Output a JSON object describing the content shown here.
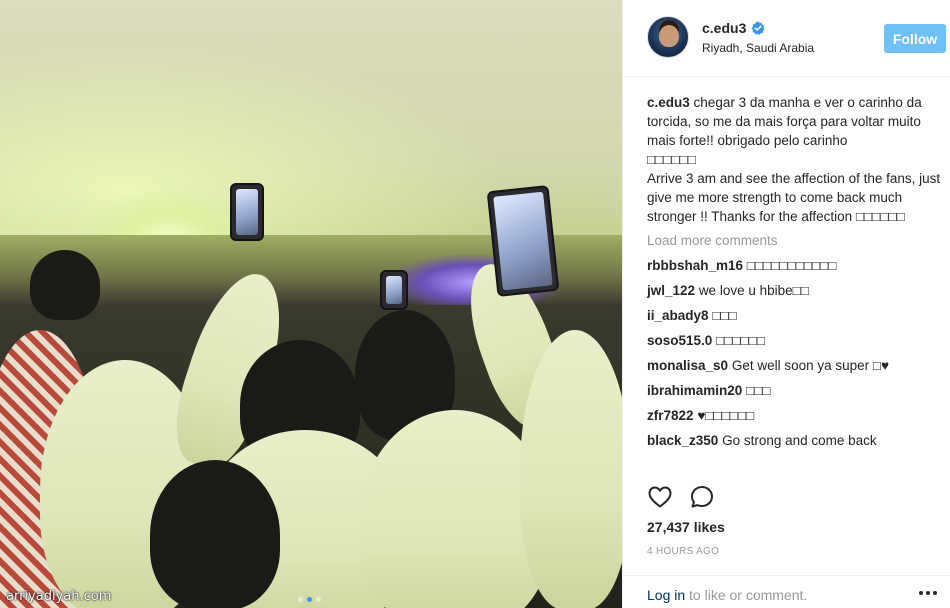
{
  "watermark": "arriyadiyah.com",
  "post": {
    "username": "c.edu3",
    "location": "Riyadh, Saudi Arabia",
    "follow_label": "Follow",
    "verified": true,
    "caption": {
      "author": "c.edu3",
      "text_pt": "chegar 3 da manha e ver o carinho da torcida, so me da mais força para voltar muito mais forte!! obrigado pelo carinho",
      "emoji_line": "□□□□□□",
      "text_en": "Arrive 3 am and see the affection of the fans, just give me more strength to come back much stronger !! Thanks for the affection □□□□□□"
    },
    "load_more": "Load more comments",
    "comments": [
      {
        "user": "rbbbshah_m16",
        "text": "□□□□□□□□□□□"
      },
      {
        "user": "jwl_122",
        "text": "we love u hbibe□□"
      },
      {
        "user": "ii_abady8",
        "text": "□□□"
      },
      {
        "user": "soso515.0",
        "text": "□□□□□□"
      },
      {
        "user": "monalisa_s0",
        "text": "Get well soon ya super □♥"
      },
      {
        "user": "ibrahimamin20",
        "text": "□□□"
      },
      {
        "user": "zfr7822",
        "text": "♥□□□□□□"
      },
      {
        "user": "black_z350",
        "text": "Go strong and come back"
      }
    ],
    "likes": "27,437 likes",
    "timestamp": "4 HOURS AGO",
    "footer": {
      "login_label": "Log in",
      "rest": " to like or comment."
    },
    "colors": {
      "follow_bg": "#70c0f5",
      "verified": "#3897f0",
      "muted": "#999999",
      "link": "#003569"
    }
  }
}
